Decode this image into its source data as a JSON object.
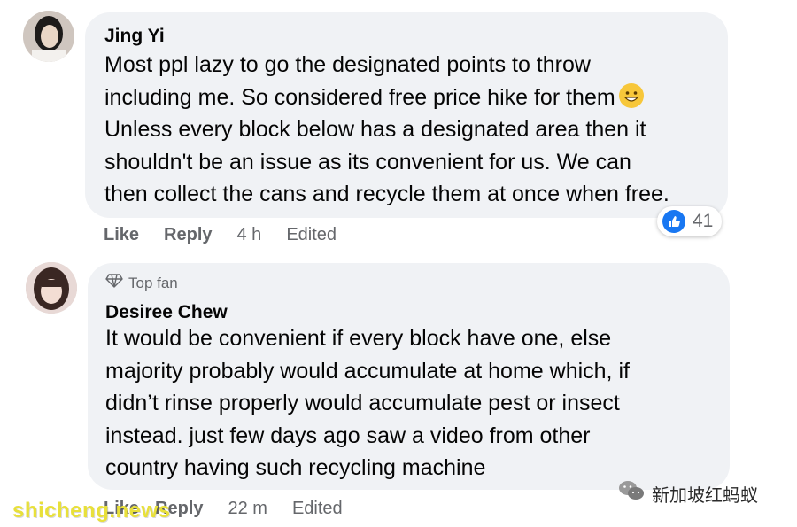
{
  "comments": [
    {
      "author": "Jing Yi",
      "lines": [
        "Most ppl lazy to go the designated points to throw",
        "including me. So considered free price hike for them",
        "Unless every block below has a designated area then it",
        "shouldn't be an issue as its convenient for us. We can",
        "then collect the cans and recycle them at once when free."
      ],
      "emoji": "grinning-face",
      "actions": {
        "like": "Like",
        "reply": "Reply",
        "time": "4 h",
        "edited": "Edited"
      },
      "reaction_count": "41"
    },
    {
      "badge": "Top fan",
      "author": "Desiree Chew",
      "lines": [
        "It would be convenient if every block have one, else",
        "majority probably would accumulate at home which, if",
        "didn’t rinse properly would accumulate pest or insect",
        "instead. just few days ago saw a video from other",
        "country having such recycling machine"
      ],
      "actions": {
        "like": "Like",
        "reply": "Reply",
        "time": "22 m",
        "edited": "Edited"
      }
    }
  ],
  "watermarks": {
    "left": "shicheng.news",
    "right": "新加坡红蚂蚁"
  },
  "colors": {
    "bubble": "#f0f2f5",
    "meta_text": "#65676b",
    "like_blue": "#1877f2",
    "watermark_yellow": "#e8e03a"
  }
}
